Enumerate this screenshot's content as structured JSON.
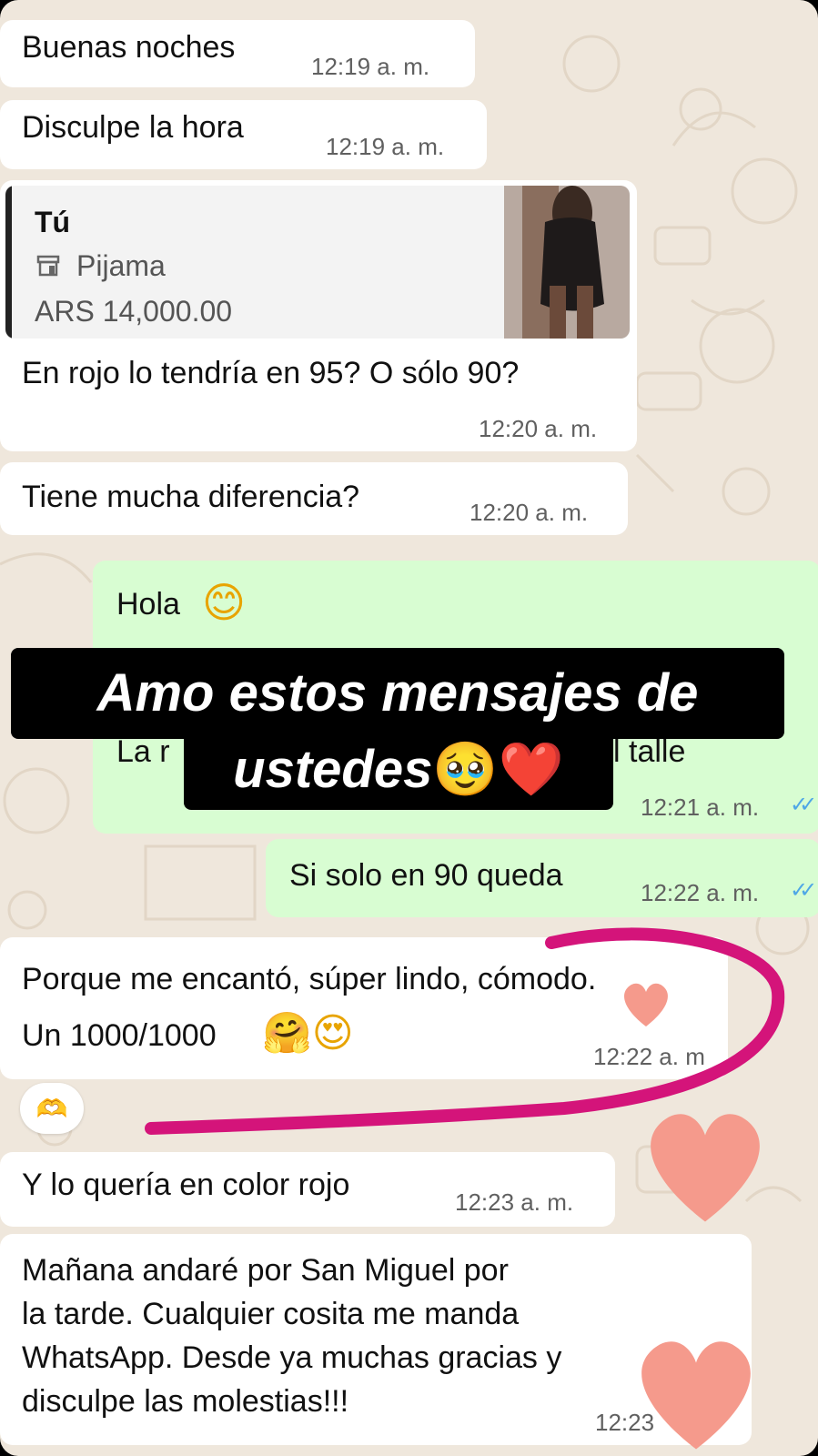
{
  "messages": [
    {
      "text": "Buenas noches",
      "time": "12:19 a. m."
    },
    {
      "text": "Disculpe la hora",
      "time": "12:19 a. m."
    },
    {
      "quote": {
        "author": "Tú",
        "product": "Pijama",
        "price": "ARS 14,000.00",
        "icon": "store-icon"
      },
      "text": "En rojo lo tendría en 95? O sólo 90?",
      "time": "12:20 a. m."
    },
    {
      "text": "Tiene mucha diferencia?",
      "time": "12:20 a. m."
    },
    {
      "text": "Hola",
      "emoji": "😊",
      "partial_left": "La r",
      "partial_right": "l talle",
      "time": "12:21 a. m.",
      "status": "read"
    },
    {
      "text": "Si solo en 90 queda",
      "time": "12:22 a. m.",
      "status": "read"
    },
    {
      "line1": "Porque me encantó, súper lindo, cómodo.",
      "line2": "Un 1000/1000",
      "emojis": "🤗😍",
      "time": "12:22 a. m",
      "reaction": "🫶"
    },
    {
      "text": "Y lo quería en color rojo",
      "time": "12:23 a. m."
    },
    {
      "lines": [
        "Mañana andaré por San Miguel por",
        "la tarde. Cualquier cosita me manda",
        "WhatsApp. Desde ya muchas gracias y",
        "disculpe las molestias!!!"
      ],
      "time": "12:23"
    }
  ],
  "overlay": {
    "line1": "Amo estos mensajes de",
    "line2": "ustedes",
    "emojis": "🥹❤️"
  },
  "colors": {
    "incoming": "#ffffff",
    "outgoing": "#d8fdd2",
    "background": "#efe7dc",
    "highlight": "#d4147a",
    "hearts": "#f59a8c",
    "ticks": "#4fa7e6"
  }
}
